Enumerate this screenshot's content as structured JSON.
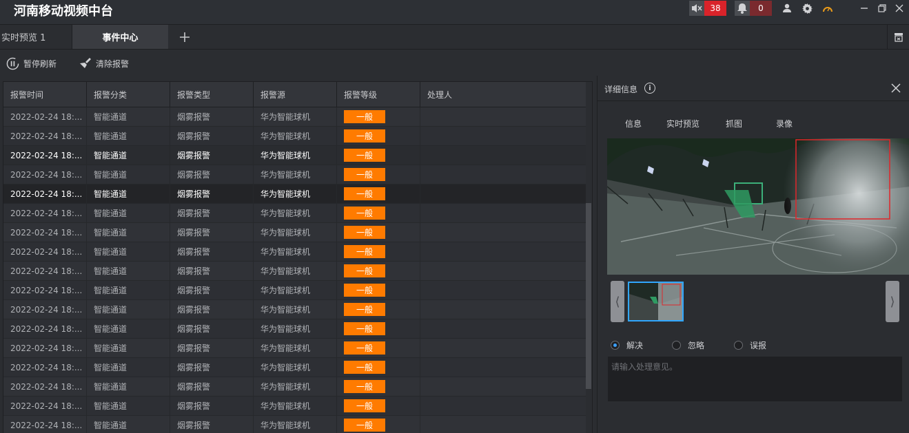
{
  "app": {
    "title": "河南移动视频中台",
    "mute_count": "38",
    "alarm_count": "0",
    "colors": {
      "badge": "#d9232a",
      "level": "#ff7b00",
      "accent": "#30a7ff"
    }
  },
  "tabs": [
    {
      "label": "实时预览 1"
    },
    {
      "label": "事件中心"
    }
  ],
  "toolbar": {
    "pause_label": "暂停刷新",
    "clear_label": "清除报警"
  },
  "table": {
    "columns": [
      "报警时间",
      "报警分类",
      "报警类型",
      "报警源",
      "报警等级",
      "处理人"
    ],
    "rows": [
      {
        "time": "2022-02-24 18:...",
        "category": "智能通道",
        "type": "烟雾报警",
        "source": "华为智能球机",
        "level": "一般",
        "handler": ""
      },
      {
        "time": "2022-02-24 18:...",
        "category": "智能通道",
        "type": "烟雾报警",
        "source": "华为智能球机",
        "level": "一般",
        "handler": ""
      },
      {
        "time": "2022-02-24 18:...",
        "category": "智能通道",
        "type": "烟雾报警",
        "source": "华为智能球机",
        "level": "一般",
        "handler": ""
      },
      {
        "time": "2022-02-24 18:...",
        "category": "智能通道",
        "type": "烟雾报警",
        "source": "华为智能球机",
        "level": "一般",
        "handler": ""
      },
      {
        "time": "2022-02-24 18:...",
        "category": "智能通道",
        "type": "烟雾报警",
        "source": "华为智能球机",
        "level": "一般",
        "handler": ""
      },
      {
        "time": "2022-02-24 18:...",
        "category": "智能通道",
        "type": "烟雾报警",
        "source": "华为智能球机",
        "level": "一般",
        "handler": ""
      },
      {
        "time": "2022-02-24 18:...",
        "category": "智能通道",
        "type": "烟雾报警",
        "source": "华为智能球机",
        "level": "一般",
        "handler": ""
      },
      {
        "time": "2022-02-24 18:...",
        "category": "智能通道",
        "type": "烟雾报警",
        "source": "华为智能球机",
        "level": "一般",
        "handler": ""
      },
      {
        "time": "2022-02-24 18:...",
        "category": "智能通道",
        "type": "烟雾报警",
        "source": "华为智能球机",
        "level": "一般",
        "handler": ""
      },
      {
        "time": "2022-02-24 18:...",
        "category": "智能通道",
        "type": "烟雾报警",
        "source": "华为智能球机",
        "level": "一般",
        "handler": ""
      },
      {
        "time": "2022-02-24 18:...",
        "category": "智能通道",
        "type": "烟雾报警",
        "source": "华为智能球机",
        "level": "一般",
        "handler": ""
      },
      {
        "time": "2022-02-24 18:...",
        "category": "智能通道",
        "type": "烟雾报警",
        "source": "华为智能球机",
        "level": "一般",
        "handler": ""
      },
      {
        "time": "2022-02-24 18:...",
        "category": "智能通道",
        "type": "烟雾报警",
        "source": "华为智能球机",
        "level": "一般",
        "handler": ""
      },
      {
        "time": "2022-02-24 18:...",
        "category": "智能通道",
        "type": "烟雾报警",
        "source": "华为智能球机",
        "level": "一般",
        "handler": ""
      },
      {
        "time": "2022-02-24 18:...",
        "category": "智能通道",
        "type": "烟雾报警",
        "source": "华为智能球机",
        "level": "一般",
        "handler": ""
      },
      {
        "time": "2022-02-24 18:...",
        "category": "智能通道",
        "type": "烟雾报警",
        "source": "华为智能球机",
        "level": "一般",
        "handler": ""
      },
      {
        "time": "2022-02-24 18:...",
        "category": "智能通道",
        "type": "烟雾报警",
        "source": "华为智能球机",
        "level": "一般",
        "handler": ""
      }
    ],
    "highlighted_rows": [
      2,
      4
    ],
    "selected_row": 4
  },
  "detail": {
    "title": "详细信息",
    "tabs": [
      "信息",
      "实时预览",
      "抓图",
      "录像"
    ],
    "options": [
      {
        "label": "解决",
        "checked": true
      },
      {
        "label": "忽略",
        "checked": false
      },
      {
        "label": "误报",
        "checked": false
      }
    ],
    "comment_placeholder": "请输入处理意见。"
  }
}
